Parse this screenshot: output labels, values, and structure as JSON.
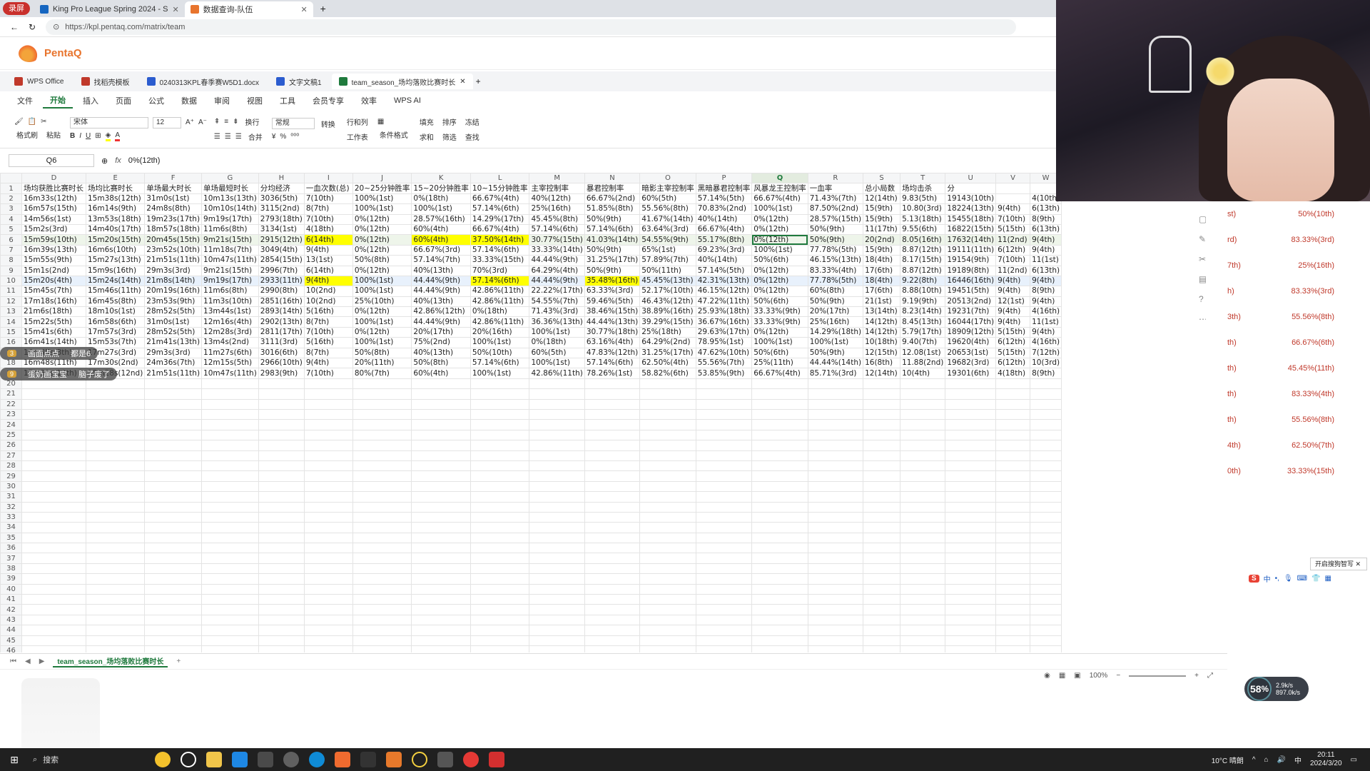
{
  "browser": {
    "rec_label": "录屏",
    "tabs": [
      {
        "title": "King Pro League Spring 2024 - S",
        "icon_color": "#1565c0"
      },
      {
        "title": "数据查询-队伍",
        "icon_color": "#e8742d"
      }
    ],
    "url": "https://kpl.pentaq.com/matrix/team"
  },
  "site": {
    "name": "PentaQ"
  },
  "wps": {
    "doc_tabs": [
      {
        "label": "WPS Office",
        "color": "#c0392b"
      },
      {
        "label": "找稻壳模板",
        "color": "#c0392b"
      },
      {
        "label": "0240313KPL春季赛W5D1.docx",
        "color": "#2b5ccf"
      },
      {
        "label": "文字文稿1",
        "color": "#2b5ccf"
      },
      {
        "label": "team_season_场均落败比赛时长",
        "color": "#1f7a3d"
      }
    ],
    "menu": [
      "文件",
      "开始",
      "插入",
      "页面",
      "公式",
      "数据",
      "审阅",
      "视图",
      "工具",
      "会员专享",
      "效率",
      "WPS AI"
    ],
    "active_menu": "开始",
    "toolbar": {
      "font_name": "宋体",
      "font_size": "12",
      "number_format": "常规",
      "labels": [
        "格式刷",
        "粘贴",
        "换行",
        "合并",
        "转换",
        "行和列",
        "工作表",
        "条件格式",
        "填充",
        "排序",
        "冻结",
        "求和",
        "筛选",
        "查找"
      ]
    },
    "formula": {
      "cell_ref": "Q6",
      "fx": "fx",
      "value": "0%(12th)"
    }
  },
  "sheet": {
    "columns": [
      "D",
      "E",
      "F",
      "G",
      "H",
      "I",
      "J",
      "K",
      "L",
      "M",
      "N",
      "O",
      "P",
      "Q",
      "R",
      "S",
      "T",
      "U",
      "V",
      "W"
    ],
    "selected_column": "Q",
    "headers": [
      "场均获胜比赛时长",
      "场均比赛时长",
      "单场最大时长",
      "单场最短时长",
      "分均经济",
      "一血次数(总)",
      "20~25分钟胜率",
      "15~20分钟胜率",
      "10~15分钟胜率",
      "主宰控制率",
      "暴君控制率",
      "暗影主宰控制率",
      "黑暗暴君控制率",
      "风暴龙王控制率",
      "一血率",
      "总小局数",
      "场均击杀",
      "分",
      "",
      ""
    ],
    "rows": [
      [
        "16m33s(12th)",
        "15m38s(12th)",
        "31m0s(1st)",
        "10m13s(13th)",
        "3036(5th)",
        "7(10th)",
        "100%(1st)",
        "0%(18th)",
        "66.67%(4th)",
        "40%(12th)",
        "66.67%(2nd)",
        "60%(5th)",
        "57.14%(5th)",
        "66.67%(4th)",
        "71.43%(7th)",
        "12(14th)",
        "9.83(5th)",
        "19143(10th)",
        "",
        "4(10th)"
      ],
      [
        "16m57s(15th)",
        "16m14s(9th)",
        "24m8s(8th)",
        "10m10s(14th)",
        "3115(2nd)",
        "8(7th)",
        "100%(1st)",
        "100%(1st)",
        "57.14%(6th)",
        "25%(16th)",
        "51.85%(8th)",
        "55.56%(8th)",
        "70.83%(2nd)",
        "100%(1st)",
        "87.50%(2nd)",
        "15(9th)",
        "10.80(3rd)",
        "18224(13th)",
        "9(4th)",
        "6(13th)"
      ],
      [
        "14m56s(1st)",
        "13m53s(18th)",
        "19m23s(17th)",
        "9m19s(17th)",
        "2793(18th)",
        "7(10th)",
        "0%(12th)",
        "28.57%(16th)",
        "14.29%(17th)",
        "45.45%(8th)",
        "50%(9th)",
        "41.67%(14th)",
        "40%(14th)",
        "0%(12th)",
        "28.57%(15th)",
        "15(9th)",
        "5.13(18th)",
        "15455(18th)",
        "7(10th)",
        "8(9th)"
      ],
      [
        "15m2s(3rd)",
        "14m40s(17th)",
        "18m57s(18th)",
        "11m6s(8th)",
        "3134(1st)",
        "4(18th)",
        "0%(12th)",
        "60%(4th)",
        "66.67%(4th)",
        "57.14%(6th)",
        "57.14%(6th)",
        "63.64%(3rd)",
        "66.67%(4th)",
        "0%(12th)",
        "50%(9th)",
        "11(17th)",
        "9.55(6th)",
        "16822(15th)",
        "5(15th)",
        "6(13th)"
      ],
      [
        "15m59s(10th)",
        "15m20s(15th)",
        "20m45s(15th)",
        "9m21s(15th)",
        "2915(12th)",
        "6(14th)",
        "0%(12th)",
        "60%(4th)",
        "37.50%(14th)",
        "30.77%(15th)",
        "41.03%(14th)",
        "54.55%(9th)",
        "55.17%(8th)",
        "0%(12th)",
        "50%(9th)",
        "20(2nd)",
        "8.05(16th)",
        "17632(14th)",
        "11(2nd)",
        "9(4th)"
      ],
      [
        "16m39s(13th)",
        "16m6s(10th)",
        "23m52s(10th)",
        "11m18s(7th)",
        "3049(4th)",
        "9(4th)",
        "0%(12th)",
        "66.67%(3rd)",
        "57.14%(6th)",
        "33.33%(14th)",
        "50%(9th)",
        "65%(1st)",
        "69.23%(3rd)",
        "100%(1st)",
        "77.78%(5th)",
        "15(9th)",
        "8.87(12th)",
        "19111(11th)",
        "6(12th)",
        "9(4th)"
      ],
      [
        "15m55s(9th)",
        "15m27s(13th)",
        "21m51s(11th)",
        "10m47s(11th)",
        "2854(15th)",
        "13(1st)",
        "50%(8th)",
        "57.14%(7th)",
        "33.33%(15th)",
        "44.44%(9th)",
        "31.25%(17th)",
        "57.89%(7th)",
        "40%(14th)",
        "50%(6th)",
        "46.15%(13th)",
        "18(4th)",
        "8.17(15th)",
        "19154(9th)",
        "7(10th)",
        "11(1st)"
      ],
      [
        "15m1s(2nd)",
        "15m9s(16th)",
        "29m3s(3rd)",
        "9m21s(15th)",
        "2996(7th)",
        "6(14th)",
        "0%(12th)",
        "40%(13th)",
        "70%(3rd)",
        "64.29%(4th)",
        "50%(9th)",
        "50%(11th)",
        "57.14%(5th)",
        "0%(12th)",
        "83.33%(4th)",
        "17(6th)",
        "8.87(12th)",
        "19189(8th)",
        "11(2nd)",
        "6(13th)"
      ],
      [
        "15m20s(4th)",
        "15m24s(14th)",
        "21m8s(14th)",
        "9m19s(17th)",
        "2933(11th)",
        "9(4th)",
        "100%(1st)",
        "44.44%(9th)",
        "57.14%(6th)",
        "44.44%(9th)",
        "35.48%(16th)",
        "45.45%(13th)",
        "42.31%(13th)",
        "0%(12th)",
        "77.78%(5th)",
        "18(4th)",
        "9.22(8th)",
        "16446(16th)",
        "9(4th)",
        "9(4th)"
      ],
      [
        "15m45s(7th)",
        "15m46s(11th)",
        "20m19s(16th)",
        "11m6s(8th)",
        "2990(8th)",
        "10(2nd)",
        "100%(1st)",
        "44.44%(9th)",
        "42.86%(11th)",
        "22.22%(17th)",
        "63.33%(3rd)",
        "52.17%(10th)",
        "46.15%(12th)",
        "0%(12th)",
        "60%(8th)",
        "17(6th)",
        "8.88(10th)",
        "19451(5th)",
        "9(4th)",
        "8(9th)"
      ],
      [
        "17m18s(16th)",
        "16m45s(8th)",
        "23m53s(9th)",
        "11m3s(10th)",
        "2851(16th)",
        "10(2nd)",
        "25%(10th)",
        "40%(13th)",
        "42.86%(11th)",
        "54.55%(7th)",
        "59.46%(5th)",
        "46.43%(12th)",
        "47.22%(11th)",
        "50%(6th)",
        "50%(9th)",
        "21(1st)",
        "9.19(9th)",
        "20513(2nd)",
        "12(1st)",
        "9(4th)"
      ],
      [
        "21m6s(18th)",
        "18m10s(1st)",
        "28m52s(5th)",
        "13m44s(1st)",
        "2893(14th)",
        "5(16th)",
        "0%(12th)",
        "42.86%(12th)",
        "0%(18th)",
        "71.43%(3rd)",
        "38.46%(15th)",
        "38.89%(16th)",
        "25.93%(18th)",
        "33.33%(9th)",
        "20%(17th)",
        "13(14th)",
        "8.23(14th)",
        "19231(7th)",
        "9(4th)",
        "4(16th)"
      ],
      [
        "15m22s(5th)",
        "16m58s(6th)",
        "31m0s(1st)",
        "12m16s(4th)",
        "2902(13th)",
        "8(7th)",
        "100%(1st)",
        "44.44%(9th)",
        "42.86%(11th)",
        "36.36%(13th)",
        "44.44%(13th)",
        "39.29%(15th)",
        "36.67%(16th)",
        "33.33%(9th)",
        "25%(16th)",
        "14(12th)",
        "8.45(13th)",
        "16044(17th)",
        "9(4th)",
        "11(1st)"
      ],
      [
        "15m41s(6th)",
        "17m57s(3rd)",
        "28m52s(5th)",
        "12m28s(3rd)",
        "2811(17th)",
        "7(10th)",
        "0%(12th)",
        "20%(17th)",
        "20%(16th)",
        "100%(1st)",
        "30.77%(18th)",
        "25%(18th)",
        "29.63%(17th)",
        "0%(12th)",
        "14.29%(18th)",
        "14(12th)",
        "5.79(17th)",
        "18909(12th)",
        "5(15th)",
        "9(4th)"
      ],
      [
        "16m41s(14th)",
        "15m53s(7th)",
        "21m41s(13th)",
        "13m4s(2nd)",
        "3111(3rd)",
        "5(16th)",
        "100%(1st)",
        "75%(2nd)",
        "100%(1st)",
        "0%(18th)",
        "63.16%(4th)",
        "64.29%(2nd)",
        "78.95%(1st)",
        "100%(1st)",
        "100%(1st)",
        "10(18th)",
        "9.40(7th)",
        "19620(4th)",
        "6(12th)",
        "4(16th)"
      ],
      [
        "16m45s(8th)",
        "17m27s(3rd)",
        "29m3s(3rd)",
        "11m27s(6th)",
        "3016(6th)",
        "8(7th)",
        "50%(8th)",
        "40%(13th)",
        "50%(10th)",
        "60%(5th)",
        "47.83%(12th)",
        "31.25%(17th)",
        "47.62%(10th)",
        "50%(6th)",
        "50%(9th)",
        "12(15th)",
        "12.08(1st)",
        "20653(1st)",
        "5(15th)",
        "7(12th)"
      ],
      [
        "16m48s(11th)",
        "17m30s(2nd)",
        "24m36s(7th)",
        "12m15s(5th)",
        "2966(10th)",
        "9(4th)",
        "20%(11th)",
        "50%(8th)",
        "57.14%(6th)",
        "100%(1st)",
        "57.14%(6th)",
        "62.50%(4th)",
        "55.56%(7th)",
        "25%(11th)",
        "44.44%(14th)",
        "16(8th)",
        "11.88(2nd)",
        "19682(3rd)",
        "6(12th)",
        "10(3rd)"
      ],
      [
        "15m51s(11th)",
        "15m28s(12nd)",
        "21m51s(11th)",
        "10m47s(11th)",
        "2983(9th)",
        "7(10th)",
        "80%(7th)",
        "60%(4th)",
        "100%(1st)",
        "42.86%(11th)",
        "78.26%(1st)",
        "58.82%(6th)",
        "53.85%(9th)",
        "66.67%(4th)",
        "85.71%(3rd)",
        "12(14th)",
        "10(4th)",
        "19301(6th)",
        "4(18th)",
        "8(9th)"
      ]
    ],
    "highlights": [
      {
        "row": 4,
        "cols": [
          5,
          7,
          8
        ]
      },
      {
        "row": 8,
        "cols": [
          5,
          8,
          10
        ]
      }
    ],
    "selected_row": 8,
    "band_row": 4,
    "active_cell": {
      "row": 4,
      "col": 13
    },
    "total_rows": 46,
    "sheet_tab": "team_season_场均落败比赛时长",
    "zoom": "100%"
  },
  "side_panel": {
    "rows": [
      [
        "st)",
        "50%(10th)"
      ],
      [
        "rd)",
        "83.33%(3rd)"
      ],
      [
        "7th)",
        "25%(16th)"
      ],
      [
        "h)",
        "83.33%(3rd)"
      ],
      [
        "3th)",
        "55.56%(8th)"
      ],
      [
        "th)",
        "66.67%(6th)"
      ],
      [
        "th)",
        "45.45%(11th)"
      ],
      [
        "th)",
        "83.33%(4th)"
      ],
      [
        "th)",
        "55.56%(8th)"
      ],
      [
        "4th)",
        "62.50%(7th)"
      ],
      [
        "0th)",
        "33.33%(15th)"
      ]
    ]
  },
  "danmaku": [
    {
      "lv": "3",
      "user": "画面点点",
      "text": "都是6"
    },
    {
      "lv": "9",
      "user": "蛋奶画宝宝",
      "text": "脑子废了"
    }
  ],
  "overlay": {
    "speed": "58",
    "speed_unit": "%",
    "up": "2.9k/s",
    "down": "897.0k/s",
    "tooltip": "开启搜狗智写"
  },
  "taskbar": {
    "search": "搜索",
    "weather": "10°C 晴朗",
    "time": "20:11",
    "date": "2024/3/20",
    "ime": "中"
  }
}
